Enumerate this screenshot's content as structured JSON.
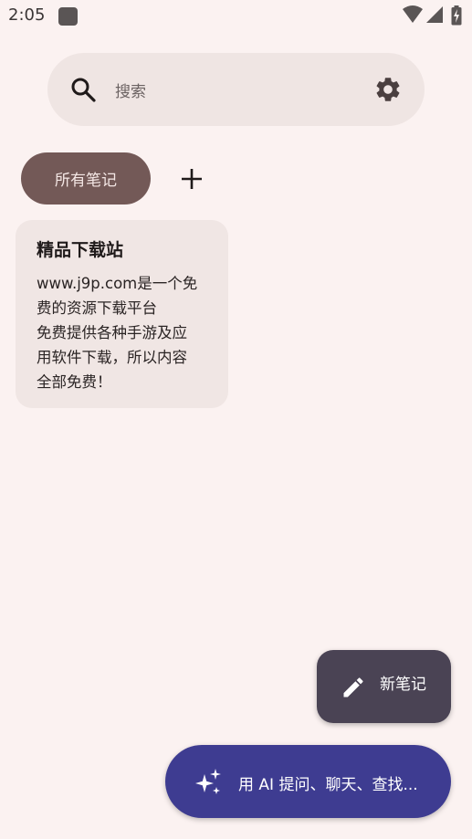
{
  "status_bar": {
    "time": "2:05",
    "icons": [
      "app-notification-icon",
      "wifi-icon",
      "signal-icon",
      "battery-charging-icon"
    ]
  },
  "search": {
    "placeholder": "搜索",
    "left_icon": "search-icon",
    "right_icon": "gear-icon"
  },
  "filters": {
    "chips": [
      {
        "label": "所有笔记",
        "selected": true
      }
    ],
    "add_icon": "add-icon"
  },
  "notes": [
    {
      "title": "精品下载站",
      "body_lines": [
        "www.j9p.com是一个免",
        "费的资源下载平台",
        "免费提供各种手游及应",
        "用软件下载，所以内容",
        "全部免费！"
      ]
    }
  ],
  "fab": {
    "label": "新笔记",
    "icon": "pencil-icon"
  },
  "ai_bar": {
    "label": "用 AI 提问、聊天、查找...",
    "icon": "sparkle-icon"
  },
  "colors": {
    "background": "#FBF2F1",
    "search_bar": "#EFE5E3",
    "chip_selected": "#735957",
    "card": "#F0E6E4",
    "fab": "#4A4354",
    "ai_bar": "#3E3C91"
  }
}
